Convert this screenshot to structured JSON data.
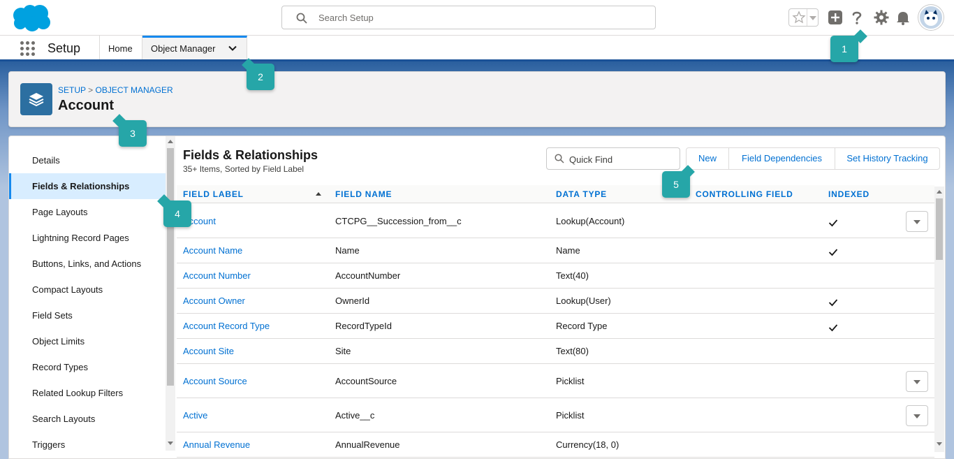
{
  "header": {
    "search_placeholder": "Search Setup"
  },
  "nav": {
    "app_name": "Setup",
    "tabs": [
      {
        "label": "Home"
      },
      {
        "label": "Object Manager"
      }
    ]
  },
  "page_header": {
    "breadcrumb": [
      "SETUP",
      "OBJECT MANAGER"
    ],
    "breadcrumb_sep": ">",
    "title": "Account"
  },
  "sidebar": {
    "items": [
      {
        "label": "Details"
      },
      {
        "label": "Fields & Relationships"
      },
      {
        "label": "Page Layouts"
      },
      {
        "label": "Lightning Record Pages"
      },
      {
        "label": "Buttons, Links, and Actions"
      },
      {
        "label": "Compact Layouts"
      },
      {
        "label": "Field Sets"
      },
      {
        "label": "Object Limits"
      },
      {
        "label": "Record Types"
      },
      {
        "label": "Related Lookup Filters"
      },
      {
        "label": "Search Layouts"
      },
      {
        "label": "Triggers"
      }
    ]
  },
  "content": {
    "title": "Fields & Relationships",
    "subtitle": "35+ Items, Sorted by Field Label",
    "quick_find_placeholder": "Quick Find",
    "buttons": {
      "new": "New",
      "field_dependencies": "Field Dependencies",
      "set_history_tracking": "Set History Tracking"
    },
    "columns": [
      "FIELD LABEL",
      "FIELD NAME",
      "DATA TYPE",
      "CONTROLLING FIELD",
      "INDEXED"
    ],
    "rows": [
      {
        "label": "Account",
        "name": "CTCPG__Succession_from__c",
        "type": "Lookup(Account)",
        "controlling": "",
        "indexed": true,
        "menu": true
      },
      {
        "label": "Account Name",
        "name": "Name",
        "type": "Name",
        "controlling": "",
        "indexed": true,
        "menu": false
      },
      {
        "label": "Account Number",
        "name": "AccountNumber",
        "type": "Text(40)",
        "controlling": "",
        "indexed": false,
        "menu": false
      },
      {
        "label": "Account Owner",
        "name": "OwnerId",
        "type": "Lookup(User)",
        "controlling": "",
        "indexed": true,
        "menu": false
      },
      {
        "label": "Account Record Type",
        "name": "RecordTypeId",
        "type": "Record Type",
        "controlling": "",
        "indexed": true,
        "menu": false
      },
      {
        "label": "Account Site",
        "name": "Site",
        "type": "Text(80)",
        "controlling": "",
        "indexed": false,
        "menu": false
      },
      {
        "label": "Account Source",
        "name": "AccountSource",
        "type": "Picklist",
        "controlling": "",
        "indexed": false,
        "menu": true
      },
      {
        "label": "Active",
        "name": "Active__c",
        "type": "Picklist",
        "controlling": "",
        "indexed": false,
        "menu": true
      },
      {
        "label": "Annual Revenue",
        "name": "AnnualRevenue",
        "type": "Currency(18, 0)",
        "controlling": "",
        "indexed": false,
        "menu": false
      }
    ]
  },
  "callouts": [
    "1",
    "2",
    "3",
    "4",
    "5"
  ],
  "colors": {
    "brand_blue": "#1b5297",
    "link": "#0070d2",
    "callout": "#26a6a8",
    "active_item": "#d8edff"
  }
}
